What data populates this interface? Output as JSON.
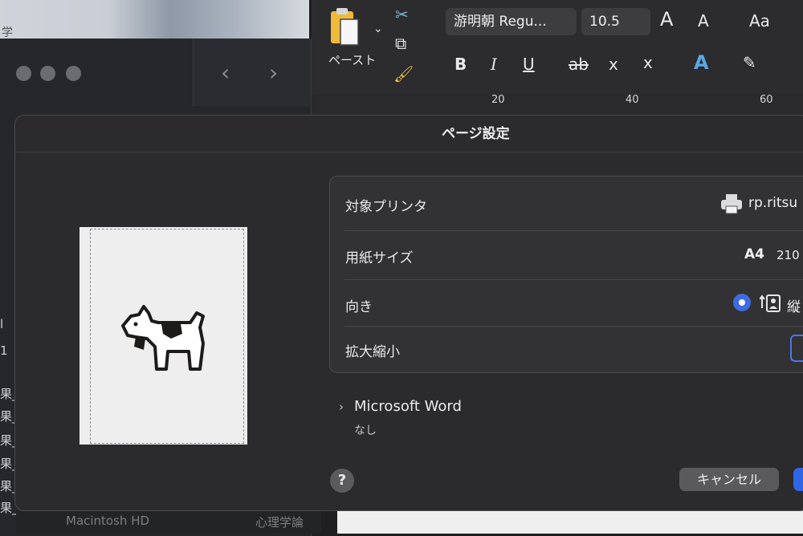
{
  "background": {
    "photo_label": "学",
    "sidebar_chars": [
      "l",
      "1",
      "果_",
      "果_",
      "果_",
      "果_",
      "果_",
      "果_"
    ],
    "status_items": [
      "Macintosh HD",
      "心理学論"
    ]
  },
  "ribbon": {
    "paste_label": "ペースト",
    "font_name": "游明朝 Regu...",
    "font_size": "10.5",
    "grow_font": "A",
    "shrink_font": "A",
    "change_case": "Aa",
    "bold": "B",
    "italic": "I",
    "underline": "U",
    "strikethrough": "ab",
    "subscript": "x",
    "superscript": "x",
    "text_effects": "A",
    "ruler_marks": [
      "20",
      "40",
      "60"
    ]
  },
  "dialog": {
    "title": "ページ設定",
    "rows": {
      "printer": {
        "label": "対象プリンタ",
        "value": "rp.ritsu"
      },
      "paper": {
        "label": "用紙サイズ",
        "value_size": "A4",
        "value_dims": "210"
      },
      "orientation": {
        "label": "向き",
        "value": "縦"
      },
      "scale": {
        "label": "拡大縮小"
      }
    },
    "app_section": {
      "title": "Microsoft Word",
      "value": "なし"
    },
    "help_label": "?",
    "cancel_label": "キャンセル"
  },
  "colors": {
    "accent": "#2f66e6",
    "dialog_bg": "#2b2b2d"
  },
  "icons": {
    "preview": "dogcow-icon",
    "printer": "printer-icon",
    "orientation": "portrait-person-icon",
    "paste": "clipboard-icon"
  }
}
